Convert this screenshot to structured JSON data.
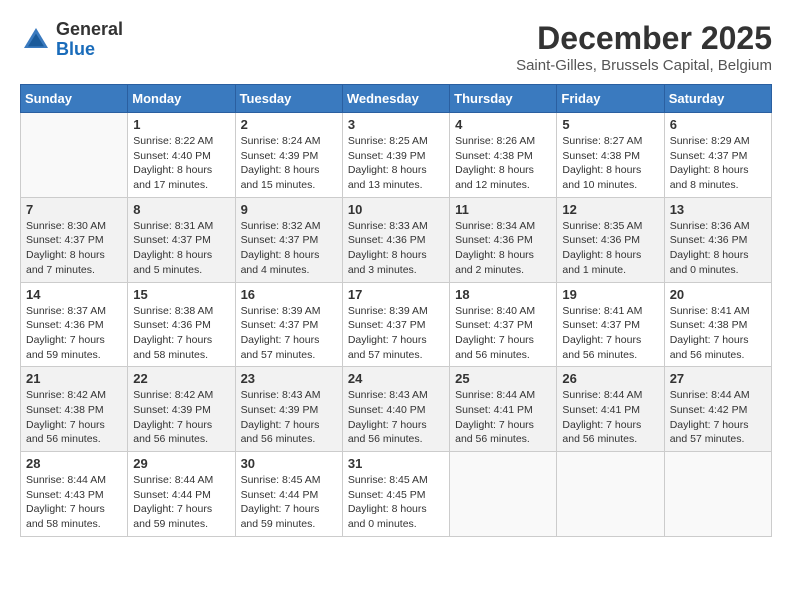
{
  "header": {
    "logo": {
      "general": "General",
      "blue": "Blue"
    },
    "title": "December 2025",
    "subtitle": "Saint-Gilles, Brussels Capital, Belgium"
  },
  "weekdays": [
    "Sunday",
    "Monday",
    "Tuesday",
    "Wednesday",
    "Thursday",
    "Friday",
    "Saturday"
  ],
  "weeks": [
    [
      {
        "day": "",
        "info": ""
      },
      {
        "day": "1",
        "info": "Sunrise: 8:22 AM\nSunset: 4:40 PM\nDaylight: 8 hours\nand 17 minutes."
      },
      {
        "day": "2",
        "info": "Sunrise: 8:24 AM\nSunset: 4:39 PM\nDaylight: 8 hours\nand 15 minutes."
      },
      {
        "day": "3",
        "info": "Sunrise: 8:25 AM\nSunset: 4:39 PM\nDaylight: 8 hours\nand 13 minutes."
      },
      {
        "day": "4",
        "info": "Sunrise: 8:26 AM\nSunset: 4:38 PM\nDaylight: 8 hours\nand 12 minutes."
      },
      {
        "day": "5",
        "info": "Sunrise: 8:27 AM\nSunset: 4:38 PM\nDaylight: 8 hours\nand 10 minutes."
      },
      {
        "day": "6",
        "info": "Sunrise: 8:29 AM\nSunset: 4:37 PM\nDaylight: 8 hours\nand 8 minutes."
      }
    ],
    [
      {
        "day": "7",
        "info": "Sunrise: 8:30 AM\nSunset: 4:37 PM\nDaylight: 8 hours\nand 7 minutes."
      },
      {
        "day": "8",
        "info": "Sunrise: 8:31 AM\nSunset: 4:37 PM\nDaylight: 8 hours\nand 5 minutes."
      },
      {
        "day": "9",
        "info": "Sunrise: 8:32 AM\nSunset: 4:37 PM\nDaylight: 8 hours\nand 4 minutes."
      },
      {
        "day": "10",
        "info": "Sunrise: 8:33 AM\nSunset: 4:36 PM\nDaylight: 8 hours\nand 3 minutes."
      },
      {
        "day": "11",
        "info": "Sunrise: 8:34 AM\nSunset: 4:36 PM\nDaylight: 8 hours\nand 2 minutes."
      },
      {
        "day": "12",
        "info": "Sunrise: 8:35 AM\nSunset: 4:36 PM\nDaylight: 8 hours\nand 1 minute."
      },
      {
        "day": "13",
        "info": "Sunrise: 8:36 AM\nSunset: 4:36 PM\nDaylight: 8 hours\nand 0 minutes."
      }
    ],
    [
      {
        "day": "14",
        "info": "Sunrise: 8:37 AM\nSunset: 4:36 PM\nDaylight: 7 hours\nand 59 minutes."
      },
      {
        "day": "15",
        "info": "Sunrise: 8:38 AM\nSunset: 4:36 PM\nDaylight: 7 hours\nand 58 minutes."
      },
      {
        "day": "16",
        "info": "Sunrise: 8:39 AM\nSunset: 4:37 PM\nDaylight: 7 hours\nand 57 minutes."
      },
      {
        "day": "17",
        "info": "Sunrise: 8:39 AM\nSunset: 4:37 PM\nDaylight: 7 hours\nand 57 minutes."
      },
      {
        "day": "18",
        "info": "Sunrise: 8:40 AM\nSunset: 4:37 PM\nDaylight: 7 hours\nand 56 minutes."
      },
      {
        "day": "19",
        "info": "Sunrise: 8:41 AM\nSunset: 4:37 PM\nDaylight: 7 hours\nand 56 minutes."
      },
      {
        "day": "20",
        "info": "Sunrise: 8:41 AM\nSunset: 4:38 PM\nDaylight: 7 hours\nand 56 minutes."
      }
    ],
    [
      {
        "day": "21",
        "info": "Sunrise: 8:42 AM\nSunset: 4:38 PM\nDaylight: 7 hours\nand 56 minutes."
      },
      {
        "day": "22",
        "info": "Sunrise: 8:42 AM\nSunset: 4:39 PM\nDaylight: 7 hours\nand 56 minutes."
      },
      {
        "day": "23",
        "info": "Sunrise: 8:43 AM\nSunset: 4:39 PM\nDaylight: 7 hours\nand 56 minutes."
      },
      {
        "day": "24",
        "info": "Sunrise: 8:43 AM\nSunset: 4:40 PM\nDaylight: 7 hours\nand 56 minutes."
      },
      {
        "day": "25",
        "info": "Sunrise: 8:44 AM\nSunset: 4:41 PM\nDaylight: 7 hours\nand 56 minutes."
      },
      {
        "day": "26",
        "info": "Sunrise: 8:44 AM\nSunset: 4:41 PM\nDaylight: 7 hours\nand 56 minutes."
      },
      {
        "day": "27",
        "info": "Sunrise: 8:44 AM\nSunset: 4:42 PM\nDaylight: 7 hours\nand 57 minutes."
      }
    ],
    [
      {
        "day": "28",
        "info": "Sunrise: 8:44 AM\nSunset: 4:43 PM\nDaylight: 7 hours\nand 58 minutes."
      },
      {
        "day": "29",
        "info": "Sunrise: 8:44 AM\nSunset: 4:44 PM\nDaylight: 7 hours\nand 59 minutes."
      },
      {
        "day": "30",
        "info": "Sunrise: 8:45 AM\nSunset: 4:44 PM\nDaylight: 7 hours\nand 59 minutes."
      },
      {
        "day": "31",
        "info": "Sunrise: 8:45 AM\nSunset: 4:45 PM\nDaylight: 8 hours\nand 0 minutes."
      },
      {
        "day": "",
        "info": ""
      },
      {
        "day": "",
        "info": ""
      },
      {
        "day": "",
        "info": ""
      }
    ]
  ]
}
